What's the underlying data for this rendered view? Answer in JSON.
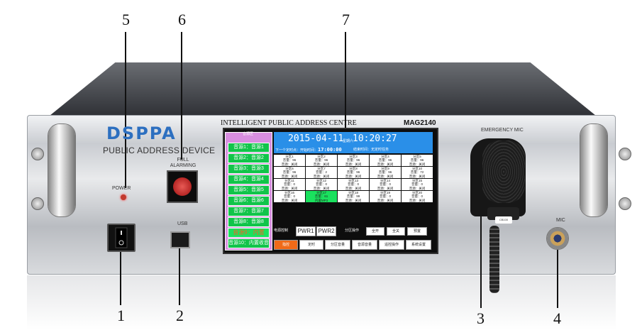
{
  "callouts": [
    "5",
    "6",
    "7",
    "1",
    "2",
    "3",
    "4"
  ],
  "brand": {
    "logo_text": "DSPPA",
    "subtitle": "PUBLIC ADDRESS DEVICE"
  },
  "panel_labels": {
    "power": "POWER",
    "fire_alarm": "FULL\nALARMING",
    "usb": "USB",
    "emergency_mic": "EMERGENCY MIC",
    "mic": "MIC",
    "mic_tag": "CB100"
  },
  "device": {
    "title": "INTELLIGENT PUBLIC ADDRESS CENTRE",
    "model": "MAG2140"
  },
  "screen": {
    "zone_panel_header": "音源区",
    "sources": [
      {
        "label": "音源1：音源1",
        "active": false
      },
      {
        "label": "音源2：音源2",
        "active": false
      },
      {
        "label": "音源3：音源3",
        "active": false
      },
      {
        "label": "音源4：音源4",
        "active": false
      },
      {
        "label": "音源5：音源5",
        "active": false
      },
      {
        "label": "音源6：音源6",
        "active": false
      },
      {
        "label": "音源7：音源7",
        "active": false
      },
      {
        "label": "音源8：音源8",
        "active": false
      },
      {
        "label": "音源9：内置MP3",
        "active": true
      },
      {
        "label": "音源10：内置收音",
        "active": false
      }
    ],
    "date": "2015-04-11",
    "weekday": "星期六",
    "time": "10:20:27",
    "next_task_label": "下一个定时点：开始时间：",
    "next_task_time": "17:00:00",
    "end_task_label": "结束时间：无定时任务",
    "zones": [
      {
        "name": "分区1",
        "volume": "音量：96",
        "source": "音源：关闭",
        "highlight": false
      },
      {
        "name": "分区2",
        "volume": "音量：96",
        "source": "音源：关闭",
        "highlight": false
      },
      {
        "name": "分区3",
        "volume": "音量：96",
        "source": "音源：关闭",
        "highlight": false
      },
      {
        "name": "分区4",
        "volume": "音量：96",
        "source": "音源：关闭",
        "highlight": false
      },
      {
        "name": "分区5",
        "volume": "音量：96",
        "source": "音源：关闭",
        "highlight": false
      },
      {
        "name": "分区6",
        "volume": "音量：96",
        "source": "音源：关闭",
        "highlight": false
      },
      {
        "name": "分区7",
        "volume": "音量：2",
        "source": "音源：关闭",
        "highlight": false
      },
      {
        "name": "分区8",
        "volume": "音量：96",
        "source": "音源：关闭",
        "highlight": false
      },
      {
        "name": "分区9",
        "volume": "音量：96",
        "source": "音源：关闭",
        "highlight": false
      },
      {
        "name": "分区10",
        "volume": "音量：72",
        "source": "音源：关闭",
        "highlight": false
      },
      {
        "name": "分区11",
        "volume": "音量：0",
        "source": "音源：关闭",
        "highlight": false
      },
      {
        "name": "分区12",
        "volume": "音量：0",
        "source": "音源：关闭",
        "highlight": false
      },
      {
        "name": "分区13",
        "volume": "音量：0",
        "source": "音源：关闭",
        "highlight": false
      },
      {
        "name": "分区14",
        "volume": "音量：0",
        "source": "音源：关闭",
        "highlight": false
      },
      {
        "name": "分区15",
        "volume": "音量：0",
        "source": "音源：关闭",
        "highlight": false
      },
      {
        "name": "分区16",
        "volume": "音量：0",
        "source": "音源：关闭",
        "highlight": false
      },
      {
        "name": "分区17",
        "volume": "音量：61",
        "source": "内置MP3",
        "highlight": true
      },
      {
        "name": "分区18",
        "volume": "音量：99",
        "source": "音源：关闭",
        "highlight": false
      },
      {
        "name": "分区19",
        "volume": "音量：0",
        "source": "音源：关闭",
        "highlight": false
      },
      {
        "name": "分区20",
        "volume": "音量：0",
        "source": "音源：关闭",
        "highlight": false
      }
    ],
    "power_control_label": "电源控制",
    "pwr1": "PWR1",
    "pwr2": "PWR2",
    "zone_op_label": "分区操作",
    "all_on": "全开",
    "all_off": "全关",
    "broadcast": "预置",
    "nav": [
      {
        "label": "指控",
        "active": true
      },
      {
        "label": "定时",
        "active": false
      },
      {
        "label": "分区音量",
        "active": false
      },
      {
        "label": "音源音量",
        "active": false
      },
      {
        "label": "遥控操作",
        "active": false
      },
      {
        "label": "系统设置",
        "active": false
      }
    ]
  },
  "colors": {
    "accent_blue": "#2a8fe8",
    "zone_green": "#11c44a",
    "highlight_green": "#1ae15e",
    "panel_pink": "#d88ee0",
    "nav_orange": "#f06a18"
  }
}
